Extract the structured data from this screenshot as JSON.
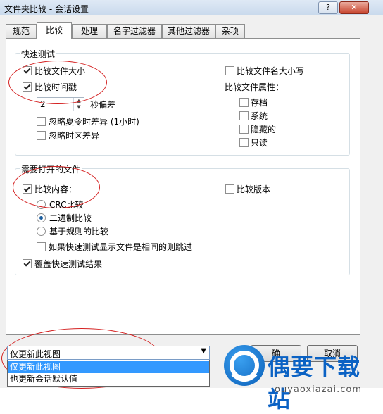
{
  "window": {
    "title": "文件夹比较 - 会话设置",
    "help_label": "?",
    "close_label": "✕"
  },
  "tabs": [
    "规范",
    "比较",
    "处理",
    "名字过滤器",
    "其他过滤器",
    "杂项"
  ],
  "active_tab": "比较",
  "quick_test": {
    "title": "快速测试",
    "compare_size": {
      "label": "比较文件大小",
      "checked": true
    },
    "compare_timestamp": {
      "label": "比较时间戳",
      "checked": true
    },
    "seconds_value": "2",
    "seconds_label": "秒偏差",
    "ignore_dst": {
      "label": "忽略夏令时差异 (1小时)",
      "checked": false
    },
    "ignore_timezone": {
      "label": "忽略时区差异",
      "checked": false
    },
    "compare_case": {
      "label": "比较文件名大小写",
      "checked": false
    },
    "attributes_title": "比较文件属性：",
    "attributes": [
      {
        "label": "存档",
        "checked": false
      },
      {
        "label": "系统",
        "checked": false
      },
      {
        "label": "隐藏的",
        "checked": false
      },
      {
        "label": "只读",
        "checked": false
      }
    ]
  },
  "open_files": {
    "title": "需要打开的文件",
    "compare_content": {
      "label": "比较内容：",
      "checked": true
    },
    "compare_version": {
      "label": "比较版本",
      "checked": false
    },
    "radios": [
      {
        "label": "CRC比较",
        "checked": false
      },
      {
        "label": "二进制比较",
        "checked": true
      },
      {
        "label": "基于规则的比较",
        "checked": false
      }
    ],
    "skip_if_same": {
      "label": "如果快速测试显示文件是相同的则跳过",
      "checked": false
    },
    "override_quick": {
      "label": "覆盖快速测试结果",
      "checked": true
    }
  },
  "bottom": {
    "scope_value": "仅更新此视图",
    "scope_options": [
      "仅更新此视图",
      "也更新会话默认值"
    ],
    "ok_label": "确",
    "cancel_label": "取消"
  },
  "watermark": {
    "main": "偶要下载站",
    "sub": "ouyaoxiazai.com"
  },
  "colors": {
    "selection": "#3399ff",
    "annotation": "#d42020",
    "logo_blue": "#0b62c4"
  }
}
